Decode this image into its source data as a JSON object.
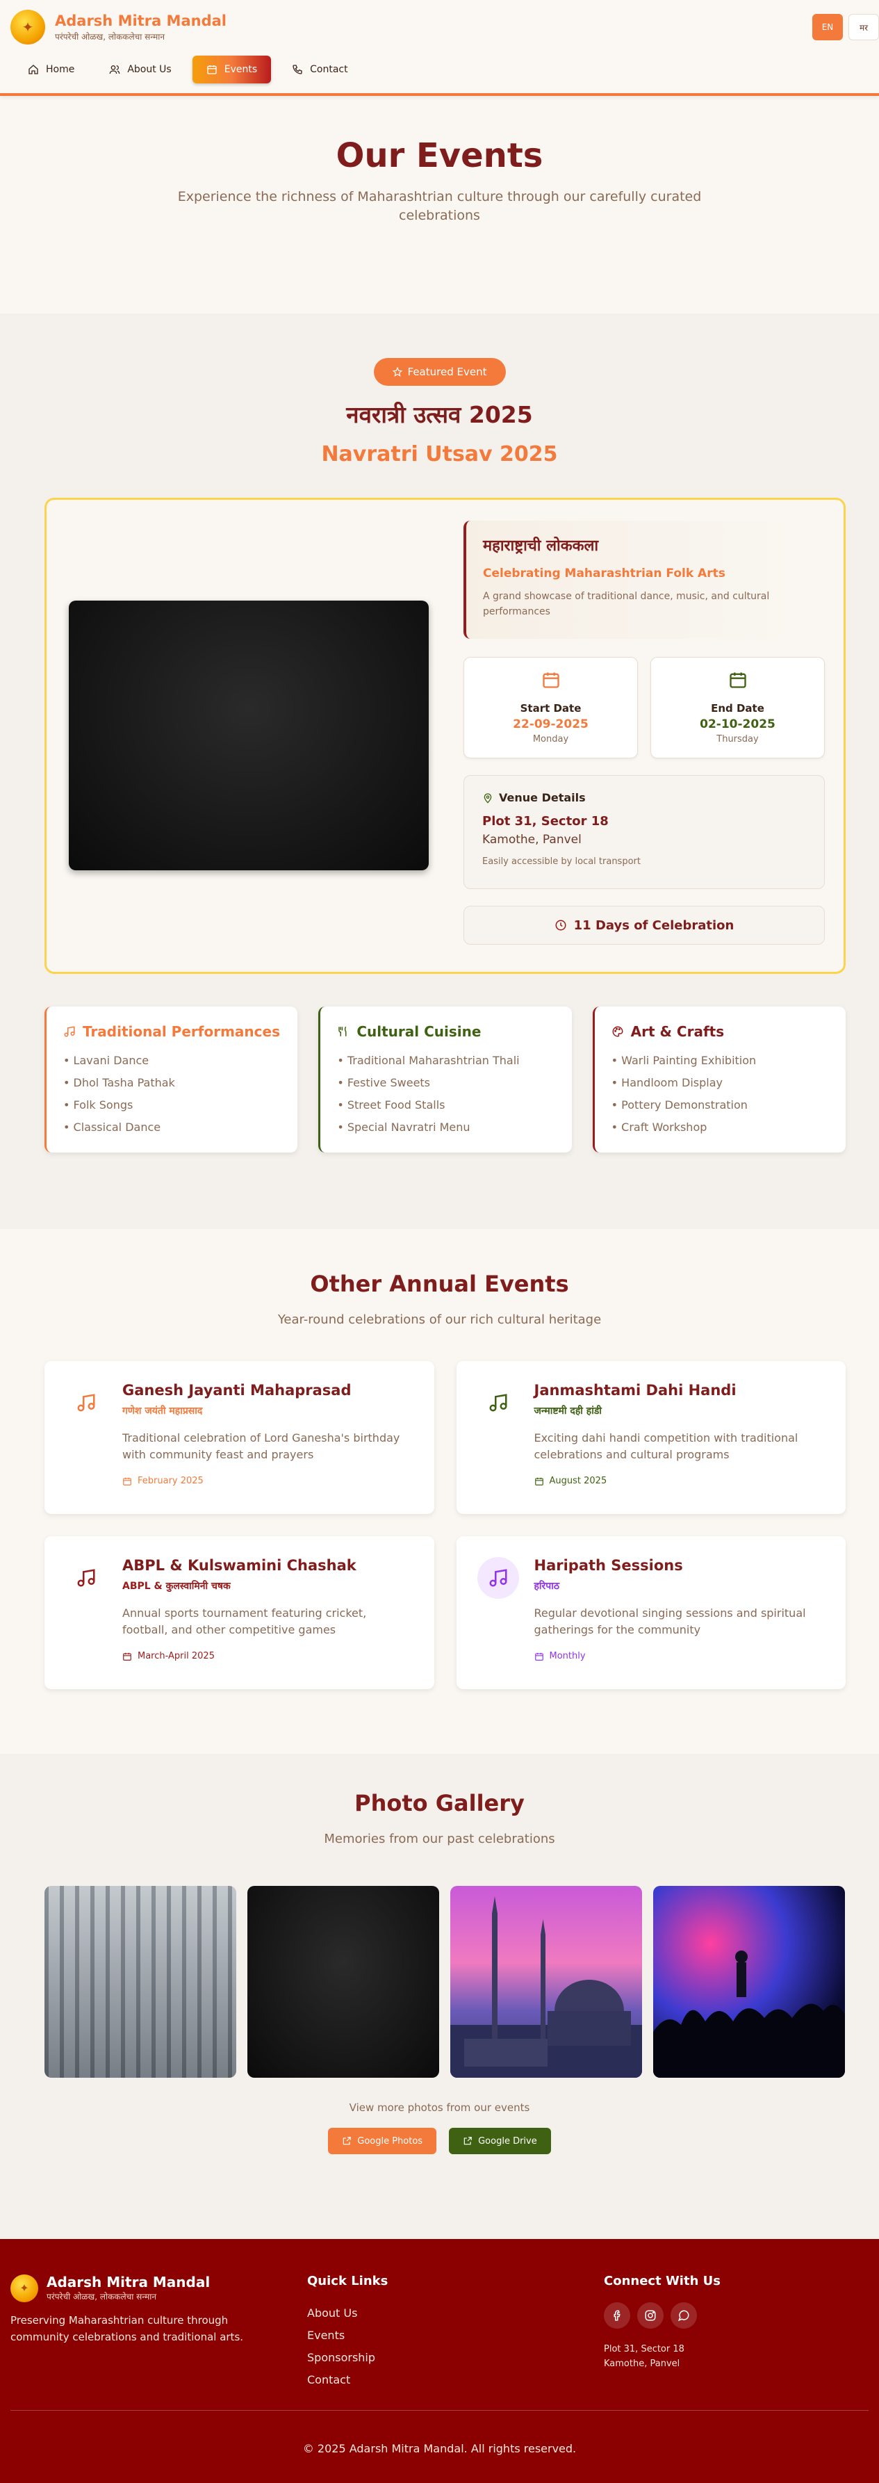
{
  "brand": {
    "name": "Adarsh Mitra Mandal",
    "tagline": "परंपरेची ओळख, लोककलेचा सन्मान"
  },
  "lang": {
    "en": "EN",
    "mr": "मर"
  },
  "nav": [
    {
      "label": "Home",
      "icon": "home-icon"
    },
    {
      "label": "About Us",
      "icon": "users-icon"
    },
    {
      "label": "Events",
      "icon": "calendar-icon"
    },
    {
      "label": "Contact",
      "icon": "phone-icon"
    }
  ],
  "hero": {
    "title": "Our Events",
    "subtitle": "Experience the richness of Maharashtrian culture through our carefully curated celebrations"
  },
  "featured": {
    "badge": "Featured Event",
    "title_mr": "नवरात्री उत्सव 2025",
    "title_en": "Navratri Utsav 2025",
    "lokkala_title": "महाराष्ट्राची लोककला",
    "lokkala_tag": "Celebrating Maharashtrian Folk Arts",
    "lokkala_desc": "A grand showcase of traditional dance, music, and cultural performances",
    "start": {
      "label": "Start Date",
      "date": "22-09-2025",
      "day": "Monday"
    },
    "end": {
      "label": "End Date",
      "date": "02-10-2025",
      "day": "Thursday"
    },
    "venue": {
      "heading": "Venue Details",
      "line1": "Plot 31, Sector 18",
      "line2": "Kamothe, Panvel",
      "note": "Easily accessible by local transport"
    },
    "duration": "11 Days of Celebration",
    "categories": [
      {
        "title": "Traditional Performances",
        "icon": "music-icon",
        "color": "#f47a3c",
        "items": [
          "• Lavani Dance",
          "• Dhol Tasha Pathak",
          "• Folk Songs",
          "• Classical Dance"
        ]
      },
      {
        "title": "Cultural Cuisine",
        "icon": "utensils-icon",
        "color": "#3f6212",
        "items": [
          "• Traditional Maharashtrian Thali",
          "• Festive Sweets",
          "• Street Food Stalls",
          "• Special Navratri Menu"
        ]
      },
      {
        "title": "Art & Crafts",
        "icon": "palette-icon",
        "color": "#991b1b",
        "items": [
          "• Warli Painting Exhibition",
          "• Handloom Display",
          "• Pottery Demonstration",
          "• Craft Workshop"
        ]
      }
    ]
  },
  "others": {
    "title": "Other Annual Events",
    "subtitle": "Year-round celebrations of our rich cultural heritage",
    "events": [
      {
        "title": "Ganesh Jayanti Mahaprasad",
        "title_mr": "गणेश जयंती महाप्रसाद",
        "desc": "Traditional celebration of Lord Ganesha's birthday with community feast and prayers",
        "when": "February 2025",
        "color": "#f47a3c",
        "bg": "#fff"
      },
      {
        "title": "Janmashtami Dahi Handi",
        "title_mr": "जन्माष्टमी दही हांडी",
        "desc": "Exciting dahi handi competition with traditional celebrations and cultural programs",
        "when": "August 2025",
        "color": "#3f6212",
        "bg": "#fff"
      },
      {
        "title": "ABPL & Kulswamini Chashak",
        "title_mr": "ABPL & कुलस्वामिनी चषक",
        "desc": "Annual sports tournament featuring cricket, football, and other competitive games",
        "when": "March-April 2025",
        "color": "#991b1b",
        "bg": "#fff"
      },
      {
        "title": "Haripath Sessions",
        "title_mr": "हरिपाठ",
        "desc": "Regular devotional singing sessions and spiritual gatherings for the community",
        "when": "Monthly",
        "color": "#9333ea",
        "bg": "#f3e8ff"
      }
    ]
  },
  "gallery": {
    "title": "Photo Gallery",
    "subtitle": "Memories from our past celebrations",
    "more": "View more photos from our events",
    "google_photos": "Google Photos",
    "google_drive": "Google Drive"
  },
  "footer": {
    "desc": "Preserving Maharashtrian culture through community celebrations and traditional arts.",
    "links_title": "Quick Links",
    "links": [
      "About Us",
      "Events",
      "Sponsorship",
      "Contact"
    ],
    "connect_title": "Connect With Us",
    "addr1": "Plot 31, Sector 18",
    "addr2": "Kamothe, Panvel",
    "copyright": "© 2025 Adarsh Mitra Mandal. All rights reserved."
  }
}
